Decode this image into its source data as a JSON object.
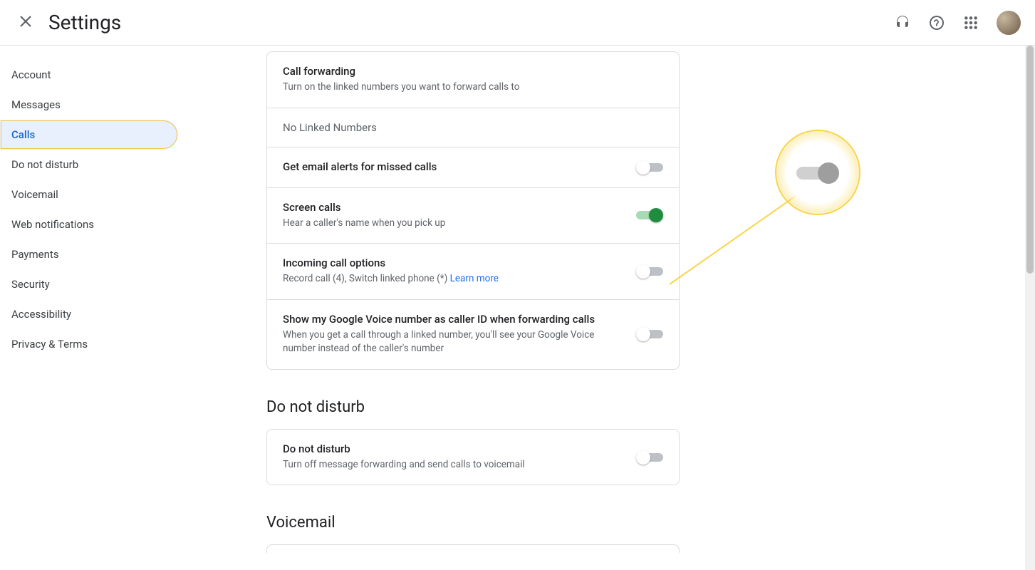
{
  "colors": {
    "accent": "#1a73e8",
    "highlight": "#f9d54a",
    "toggle_on": "#1e8e3e"
  },
  "header": {
    "title": "Settings"
  },
  "sidebar": {
    "items": [
      {
        "label": "Account"
      },
      {
        "label": "Messages"
      },
      {
        "label": "Calls"
      },
      {
        "label": "Do not disturb"
      },
      {
        "label": "Voicemail"
      },
      {
        "label": "Web notifications"
      },
      {
        "label": "Payments"
      },
      {
        "label": "Security"
      },
      {
        "label": "Accessibility"
      },
      {
        "label": "Privacy & Terms"
      }
    ],
    "active_index": 2
  },
  "settings": {
    "call_forwarding": {
      "title": "Call forwarding",
      "desc": "Turn on the linked numbers you want to forward calls to",
      "status": "No Linked Numbers"
    },
    "email_alerts": {
      "title": "Get email alerts for missed calls",
      "on": false
    },
    "screen_calls": {
      "title": "Screen calls",
      "desc": "Hear a caller's name when you pick up",
      "on": true
    },
    "incoming_options": {
      "title": "Incoming call options",
      "desc_prefix": "Record call (4), Switch linked phone (*) ",
      "learn_more": "Learn more",
      "on": false
    },
    "caller_id": {
      "title": "Show my Google Voice number as caller ID when forwarding calls",
      "desc": "When you get a call through a linked number, you'll see your Google Voice number instead of the caller's number",
      "on": false
    }
  },
  "dnd_section": {
    "header": "Do not disturb",
    "item": {
      "title": "Do not disturb",
      "desc": "Turn off message forwarding and send calls to voicemail",
      "on": false
    }
  },
  "voicemail_section": {
    "header": "Voicemail"
  }
}
